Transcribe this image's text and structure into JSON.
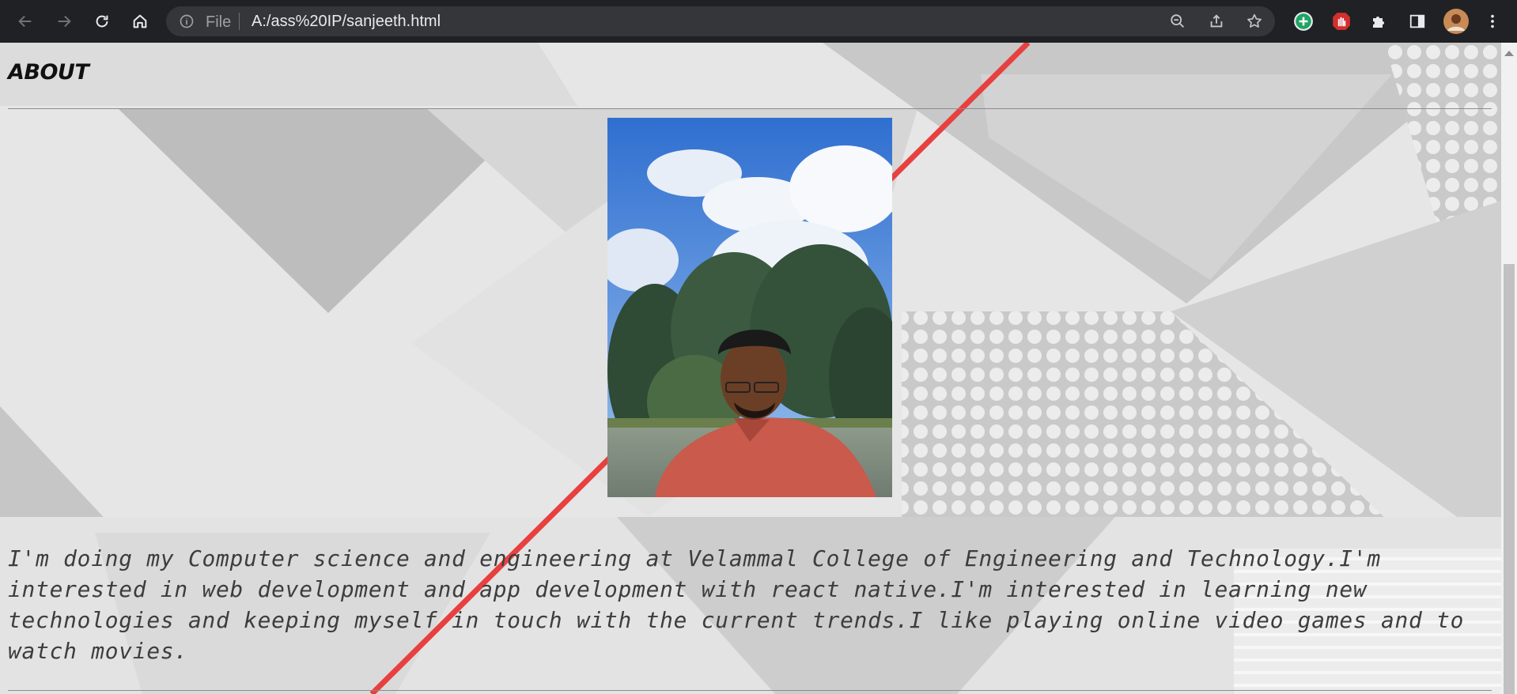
{
  "browser": {
    "scheme_label": "File",
    "url": "A:/ass%20IP/sanjeeth.html",
    "colors": {
      "frame": "#202124",
      "omnibox": "#35363a",
      "text": "#e8eaed",
      "muted": "#9aa0a6"
    },
    "icons": [
      "back-arrow-icon",
      "forward-arrow-icon",
      "reload-icon",
      "home-icon",
      "info-icon",
      "zoom-out-icon",
      "share-icon",
      "bookmark-star-icon",
      "green-plus-extension-icon",
      "red-stop-hand-extension-icon",
      "puzzle-extensions-icon",
      "side-panel-icon",
      "profile-avatar",
      "kebab-menu-icon"
    ]
  },
  "page": {
    "heading": "ABOUT",
    "about_text": "I'm doing my Computer science and engineering at Velammal College of Engineering and Technology.I'm interested in web development and app development with react native.I'm interested in learning new technologies and keeping myself in touch with the current trends.I like playing online video games and to watch movies.",
    "colors": {
      "background": "#e6e6e6",
      "accent_line": "#e8403f",
      "text": "#3d3d3d"
    }
  }
}
